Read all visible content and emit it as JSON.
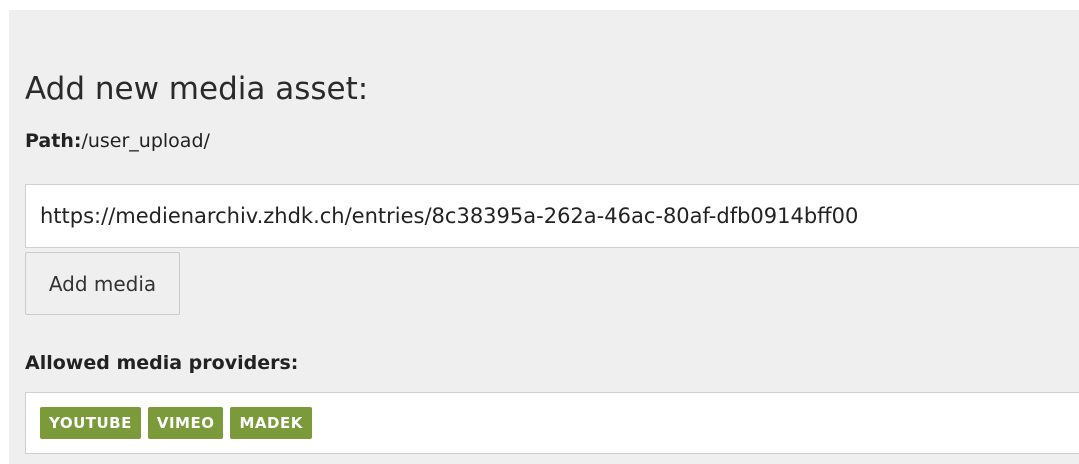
{
  "form": {
    "title": "Add new media asset:",
    "path_label": "Path:",
    "path_value": "/user_upload/",
    "url_value": "https://medienarchiv.zhdk.ch/entries/8c38395a-262a-46ac-80af-dfb0914bff00",
    "add_button_label": "Add media",
    "providers_label": "Allowed media providers:",
    "providers": [
      "YOUTUBE",
      "VIMEO",
      "MADEK"
    ]
  },
  "colors": {
    "panel_background": "#efefef",
    "provider_tag": "#7b9a3a"
  }
}
